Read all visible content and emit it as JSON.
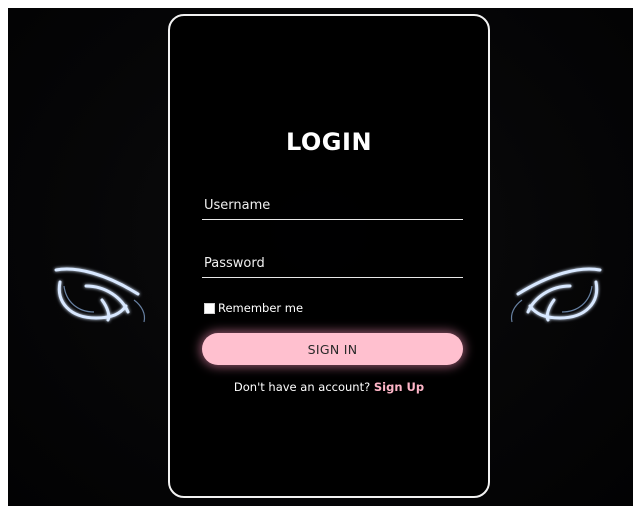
{
  "login": {
    "title": "LOGIN",
    "username_placeholder": "Username",
    "password_placeholder": "Password",
    "remember_label": "Remember me",
    "signin_label": "SIGN IN",
    "footer_text": "Don't have an account?",
    "signup_label": "Sign Up"
  },
  "colors": {
    "background": "#050506",
    "card_border": "#f2f2f2",
    "button_fill": "#ffc0cf",
    "link": "#ffb6c8",
    "headlight_glow": "#cfe3ff"
  },
  "icons": {
    "remember_checkbox": "checkbox-icon",
    "headlights": "headlight-icon"
  }
}
